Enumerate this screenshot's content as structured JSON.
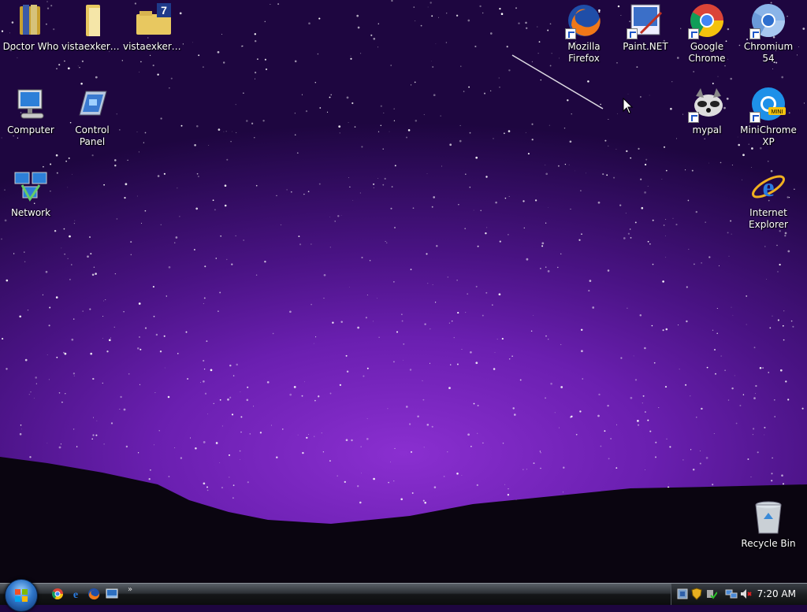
{
  "desktop": {
    "icons_left": [
      {
        "label": "Doctor Who"
      },
      {
        "label": "vistaexkerns..."
      },
      {
        "label": "vistaexkerns..."
      },
      {
        "label": "Computer"
      },
      {
        "label": "Control Panel"
      },
      {
        "label": "Network"
      }
    ],
    "icons_right": [
      {
        "label": "Mozilla Firefox"
      },
      {
        "label": "Paint.NET"
      },
      {
        "label": "Google Chrome"
      },
      {
        "label": "Chromium 54"
      },
      {
        "label": "mypal"
      },
      {
        "label": "MiniChrome XP"
      },
      {
        "label": "Internet Explorer"
      },
      {
        "label": "Recycle Bin"
      }
    ]
  },
  "taskbar": {
    "start": {
      "icon": "windows-flag-icon"
    },
    "quick_launch": [
      "chrome-icon",
      "internet-explorer-icon",
      "firefox-icon",
      "show-desktop-icon"
    ],
    "chevron": "»",
    "tray": [
      "network-manager-icon",
      "security-shield-icon",
      "safely-remove-icon",
      "network-icon",
      "volume-muted-icon"
    ],
    "clock": "7:20 AM"
  },
  "colors": {
    "sky_center": "#8a2fd0",
    "sky_edge": "#2e0b5a",
    "hills": "#0a0510"
  }
}
